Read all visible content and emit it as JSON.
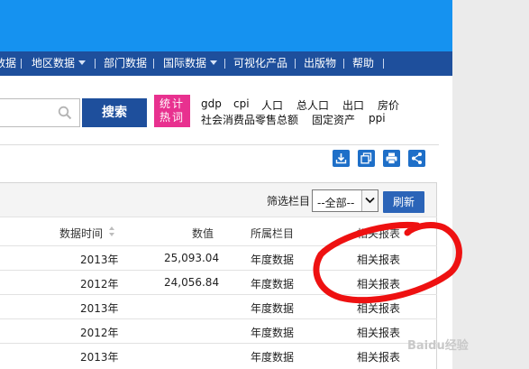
{
  "nav": {
    "items": [
      {
        "label": "数据",
        "has_caret": true
      },
      {
        "label": "地区数据",
        "has_caret": true
      },
      {
        "label": "部门数据",
        "has_caret": false
      },
      {
        "label": "国际数据",
        "has_caret": true
      },
      {
        "label": "可视化产品",
        "has_caret": false
      },
      {
        "label": "出版物",
        "has_caret": false
      },
      {
        "label": "帮助",
        "has_caret": false
      }
    ]
  },
  "search": {
    "value": "",
    "icon": "search-icon",
    "button_label": "搜索"
  },
  "hot": {
    "badge_line1": "统计",
    "badge_line2": "热词",
    "badge_color": "#e8318f",
    "row1": [
      "gdp",
      "cpi",
      "人口",
      "总人口",
      "出口",
      "房价"
    ],
    "row2": [
      "社会消费品零售总额",
      "固定资产",
      "ppi"
    ]
  },
  "toolbar": {
    "icons": [
      "download-icon",
      "copy-icon",
      "print-icon",
      "share-icon"
    ]
  },
  "filter": {
    "label": "筛选栏目",
    "selected": "--全部--",
    "refresh_label": "刷新"
  },
  "table": {
    "headers": {
      "time": "数据时间",
      "value": "数值",
      "column": "所属栏目",
      "report": "相关报表"
    },
    "rows": [
      {
        "time": "2013年",
        "value": "25,093.04",
        "column": "年度数据",
        "report": "相关报表"
      },
      {
        "time": "2012年",
        "value": "24,056.84",
        "column": "年度数据",
        "report": "相关报表"
      },
      {
        "time": "2013年",
        "value": "",
        "column": "年度数据",
        "report": "相关报表"
      },
      {
        "time": "2012年",
        "value": "",
        "column": "年度数据",
        "report": "相关报表"
      },
      {
        "time": "2013年",
        "value": "",
        "column": "年度数据",
        "report": "相关报表"
      }
    ]
  },
  "watermark": "Baidu经验",
  "colors": {
    "banner": "#1592f0",
    "nav": "#1e4f9c",
    "annotation": "#ee1111"
  }
}
